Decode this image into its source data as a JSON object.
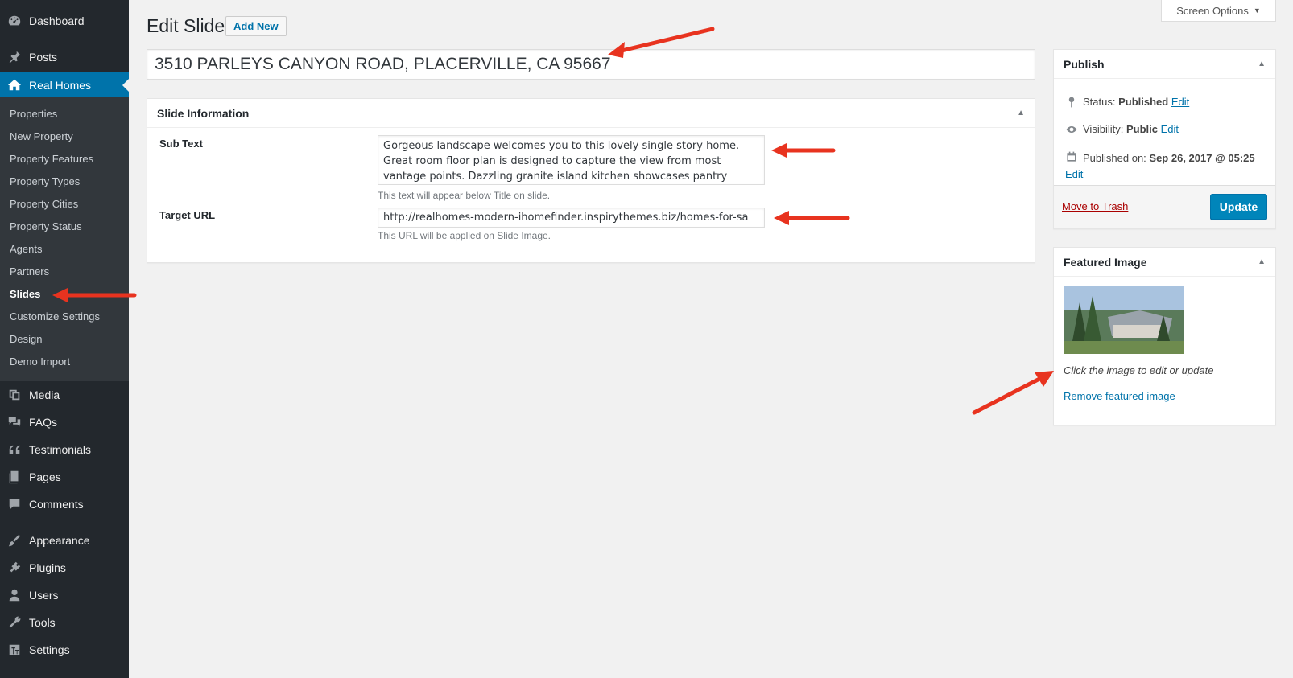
{
  "sidebar": {
    "top_items": [
      {
        "label": "Dashboard",
        "icon": "dashboard-icon"
      },
      {
        "label": "Posts",
        "icon": "pin-icon"
      },
      {
        "label": "Real Homes",
        "icon": "homes-icon"
      }
    ],
    "submenu": [
      "Properties",
      "New Property",
      "Property Features",
      "Property Types",
      "Property Cities",
      "Property Status",
      "Agents",
      "Partners",
      "Slides",
      "Customize Settings",
      "Design",
      "Demo Import"
    ],
    "bottom_items": [
      {
        "label": "Media",
        "icon": "media-icon"
      },
      {
        "label": "FAQs",
        "icon": "comments-icon"
      },
      {
        "label": "Testimonials",
        "icon": "quote-icon"
      },
      {
        "label": "Pages",
        "icon": "pages-icon"
      },
      {
        "label": "Comments",
        "icon": "comment-icon"
      },
      {
        "label": "Appearance",
        "icon": "brush-icon"
      },
      {
        "label": "Plugins",
        "icon": "plugin-icon"
      },
      {
        "label": "Users",
        "icon": "user-icon"
      },
      {
        "label": "Tools",
        "icon": "wrench-icon"
      },
      {
        "label": "Settings",
        "icon": "settings-icon"
      }
    ]
  },
  "screen_options": "Screen Options",
  "header": {
    "title": "Edit Slide",
    "add_new": "Add New"
  },
  "post_title": "3510 PARLEYS CANYON ROAD, PLACERVILLE, CA 95667",
  "slide_info": {
    "heading": "Slide Information",
    "sub_text_label": "Sub Text",
    "sub_text_value": "Gorgeous landscape welcomes you to this lovely single story home. Great room floor plan is designed to capture the view from most vantage points. Dazzling granite island kitchen showcases pantry",
    "sub_text_desc": "This text will appear below Title on slide.",
    "target_url_label": "Target URL",
    "target_url_value": "http://realhomes-modern-ihomefinder.inspirythemes.biz/homes-for-sa",
    "target_url_desc": "This URL will be applied on Slide Image."
  },
  "publish": {
    "heading": "Publish",
    "status_label": "Status:",
    "status_value": "Published",
    "visibility_label": "Visibility:",
    "visibility_value": "Public",
    "published_label": "Published on:",
    "published_value": "Sep 26, 2017 @ 05:25",
    "edit": "Edit",
    "trash": "Move to Trash",
    "update": "Update"
  },
  "featured": {
    "heading": "Featured Image",
    "hint": "Click the image to edit or update",
    "remove": "Remove featured image"
  },
  "colors": {
    "sidebar": "#23282d",
    "accent": "#0073aa",
    "annotation": "#e8331f"
  }
}
